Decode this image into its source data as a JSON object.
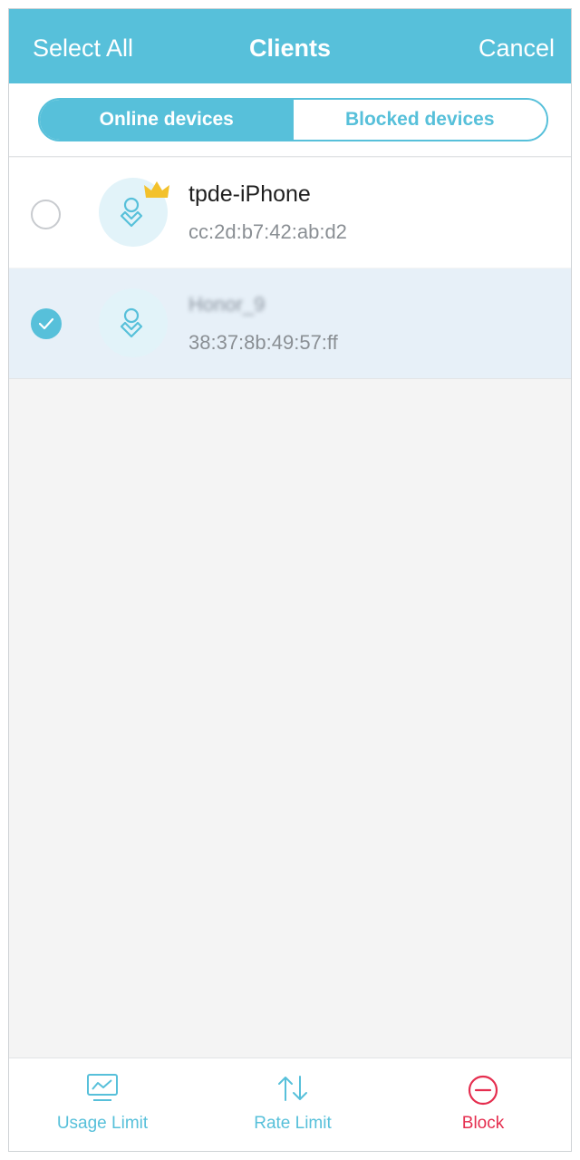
{
  "header": {
    "select_all": "Select All",
    "title": "Clients",
    "cancel": "Cancel"
  },
  "tabs": {
    "online": "Online devices",
    "blocked": "Blocked devices"
  },
  "clients": [
    {
      "name": "tpde-iPhone",
      "mac": "cc:2d:b7:42:ab:d2",
      "selected": false,
      "owner_badge": "crown-icon"
    },
    {
      "name": "Honor_9",
      "mac": "38:37:8b:49:57:ff",
      "selected": true
    }
  ],
  "toolbar": {
    "usage_limit": "Usage Limit",
    "rate_limit": "Rate Limit",
    "block": "Block"
  },
  "colors": {
    "accent": "#57c0da",
    "danger": "#e52e4f",
    "selected_row": "#e7f0f8",
    "crown": "#f3c12b"
  }
}
